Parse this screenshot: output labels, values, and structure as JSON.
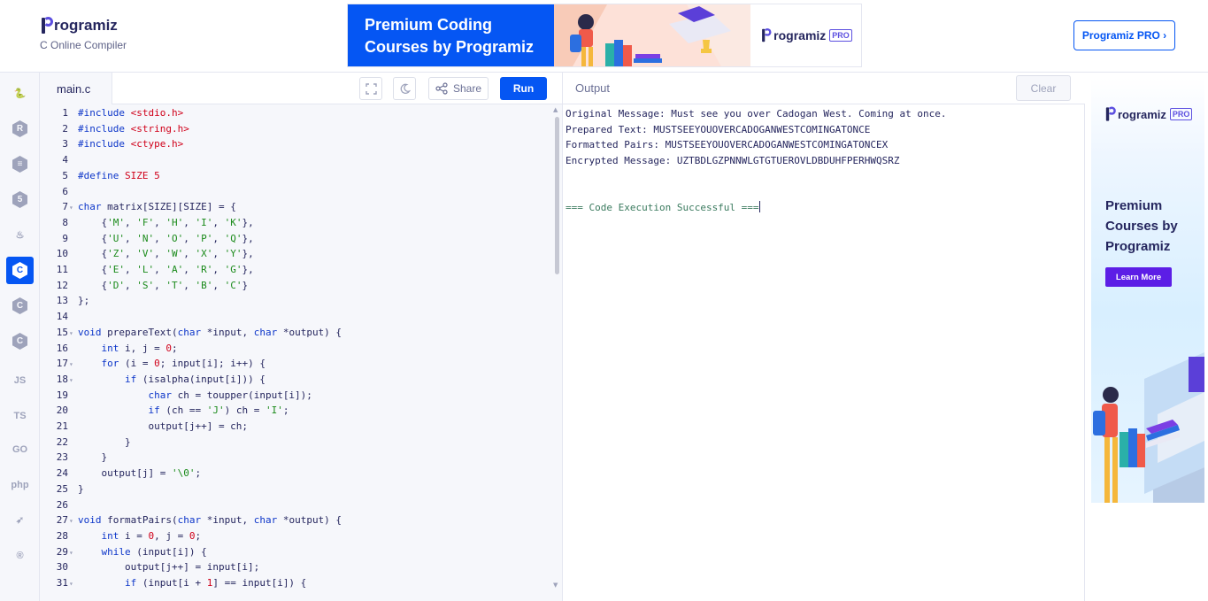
{
  "header": {
    "brand": "rogramiz",
    "subtitle": "C Online Compiler",
    "ad_banner": {
      "headline_line1": "Premium Coding",
      "headline_line2": "Courses by Programiz",
      "brand": "rogramiz",
      "badge": "PRO"
    },
    "pro_button": "Programiz PRO ›"
  },
  "sidebar": {
    "languages": [
      {
        "name": "python",
        "glyph": "🐍",
        "active": false
      },
      {
        "name": "r",
        "glyph": "R",
        "active": false
      },
      {
        "name": "sql",
        "glyph": "≡",
        "active": false
      },
      {
        "name": "html",
        "glyph": "5",
        "active": false
      },
      {
        "name": "java",
        "glyph": "♨",
        "active": false
      },
      {
        "name": "c",
        "glyph": "C",
        "active": true
      },
      {
        "name": "cpp",
        "glyph": "C",
        "active": false
      },
      {
        "name": "csharp",
        "glyph": "C",
        "active": false
      },
      {
        "name": "javascript",
        "glyph": "JS",
        "active": false
      },
      {
        "name": "typescript",
        "glyph": "TS",
        "active": false
      },
      {
        "name": "go",
        "glyph": "GO",
        "active": false
      },
      {
        "name": "php",
        "glyph": "php",
        "active": false
      },
      {
        "name": "swift",
        "glyph": "➶",
        "active": false
      },
      {
        "name": "rust",
        "glyph": "®",
        "active": false
      }
    ]
  },
  "editor": {
    "filename": "main.c",
    "share_label": "Share",
    "run_label": "Run",
    "lines": [
      {
        "n": "1",
        "f": "",
        "html": "<span class='k'>#include</span> <span class='s'>&lt;stdio.h&gt;</span>"
      },
      {
        "n": "2",
        "f": "",
        "html": "<span class='k'>#include</span> <span class='s'>&lt;string.h&gt;</span>"
      },
      {
        "n": "3",
        "f": "",
        "html": "<span class='k'>#include</span> <span class='s'>&lt;ctype.h&gt;</span>"
      },
      {
        "n": "4",
        "f": "",
        "html": ""
      },
      {
        "n": "5",
        "f": "",
        "html": "<span class='k'>#define</span> <span class='s'>SIZE 5</span>"
      },
      {
        "n": "6",
        "f": "",
        "html": ""
      },
      {
        "n": "7",
        "f": "▾",
        "html": "<span class='t'>char</span> matrix[SIZE][SIZE] = {"
      },
      {
        "n": "8",
        "f": "",
        "html": "    {<span class='c'>'M'</span>, <span class='c'>'F'</span>, <span class='c'>'H'</span>, <span class='c'>'I'</span>, <span class='c'>'K'</span>},"
      },
      {
        "n": "9",
        "f": "",
        "html": "    {<span class='c'>'U'</span>, <span class='c'>'N'</span>, <span class='c'>'O'</span>, <span class='c'>'P'</span>, <span class='c'>'Q'</span>},"
      },
      {
        "n": "10",
        "f": "",
        "html": "    {<span class='c'>'Z'</span>, <span class='c'>'V'</span>, <span class='c'>'W'</span>, <span class='c'>'X'</span>, <span class='c'>'Y'</span>},"
      },
      {
        "n": "11",
        "f": "",
        "html": "    {<span class='c'>'E'</span>, <span class='c'>'L'</span>, <span class='c'>'A'</span>, <span class='c'>'R'</span>, <span class='c'>'G'</span>},"
      },
      {
        "n": "12",
        "f": "",
        "html": "    {<span class='c'>'D'</span>, <span class='c'>'S'</span>, <span class='c'>'T'</span>, <span class='c'>'B'</span>, <span class='c'>'C'</span>}"
      },
      {
        "n": "13",
        "f": "",
        "html": "};"
      },
      {
        "n": "14",
        "f": "",
        "html": ""
      },
      {
        "n": "15",
        "f": "▾",
        "html": "<span class='t'>void</span> prepareText(<span class='t'>char</span> *input, <span class='t'>char</span> *output) {"
      },
      {
        "n": "16",
        "f": "",
        "html": "    <span class='t'>int</span> i, j = <span class='n'>0</span>;"
      },
      {
        "n": "17",
        "f": "▾",
        "html": "    <span class='k'>for</span> (i = <span class='n'>0</span>; input[i]; i++) {"
      },
      {
        "n": "18",
        "f": "▾",
        "html": "        <span class='k'>if</span> (isalpha(input[i])) {"
      },
      {
        "n": "19",
        "f": "",
        "html": "            <span class='t'>char</span> ch = toupper(input[i]);"
      },
      {
        "n": "20",
        "f": "",
        "html": "            <span class='k'>if</span> (ch == <span class='c'>'J'</span>) ch = <span class='c'>'I'</span>;"
      },
      {
        "n": "21",
        "f": "",
        "html": "            output[j++] = ch;"
      },
      {
        "n": "22",
        "f": "",
        "html": "        }"
      },
      {
        "n": "23",
        "f": "",
        "html": "    }"
      },
      {
        "n": "24",
        "f": "",
        "html": "    output[j] = <span class='c'>'\\0'</span>;"
      },
      {
        "n": "25",
        "f": "",
        "html": "}"
      },
      {
        "n": "26",
        "f": "",
        "html": ""
      },
      {
        "n": "27",
        "f": "▾",
        "html": "<span class='t'>void</span> formatPairs(<span class='t'>char</span> *input, <span class='t'>char</span> *output) {"
      },
      {
        "n": "28",
        "f": "",
        "html": "    <span class='t'>int</span> i = <span class='n'>0</span>, j = <span class='n'>0</span>;"
      },
      {
        "n": "29",
        "f": "▾",
        "html": "    <span class='k'>while</span> (input[i]) {"
      },
      {
        "n": "30",
        "f": "",
        "html": "        output[j++] = input[i];"
      },
      {
        "n": "31",
        "f": "▾",
        "html": "        <span class='k'>if</span> (input[i + <span class='n'>1</span>] == input[i]) {"
      }
    ]
  },
  "output_panel": {
    "title": "Output",
    "clear_label": "Clear",
    "lines": [
      "Original Message: Must see you over Cadogan West. Coming at once.",
      "Prepared Text: MUSTSEEYOUOVERCADOGANWESTCOMINGATONCE",
      "Formatted Pairs: MUSTSEEYOUOVERCADOGANWESTCOMINGATONCEX",
      "Encrypted Message: UZTBDLGZPNNWLGTGTUEROVLDBDUHFPERHWQSRZ",
      "",
      "",
      "=== Code Execution Successful ==="
    ]
  },
  "side_ad": {
    "brand": "rogramiz",
    "badge": "PRO",
    "title": "Premium Courses by Programiz",
    "button": "Learn More"
  }
}
